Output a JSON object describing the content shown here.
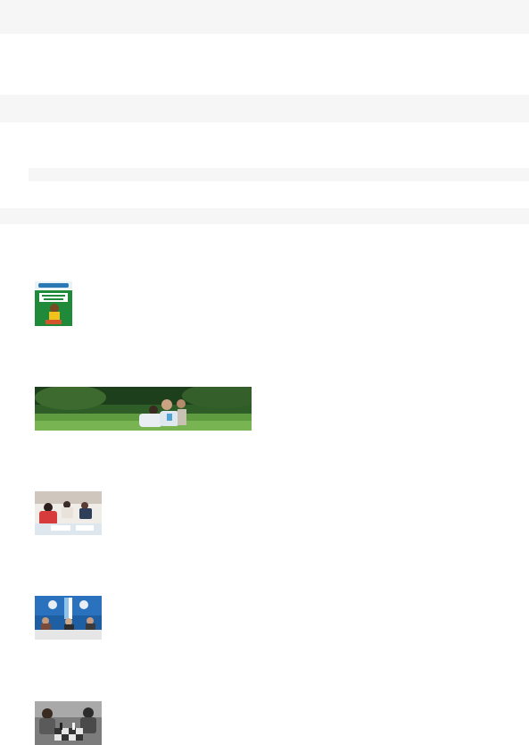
{
  "page": {
    "bands": [
      {
        "id": "top-bar"
      },
      {
        "id": "section-band-1"
      },
      {
        "id": "section-band-2"
      },
      {
        "id": "section-band-3"
      }
    ]
  },
  "thumbnails": [
    {
      "id": "publication-cover",
      "icon": "book-cover-image",
      "colors": [
        "#1f8a3a",
        "#f2c21c",
        "#ffffff"
      ]
    },
    {
      "id": "family-in-park",
      "icon": "park-photo",
      "colors": [
        "#2e5a24",
        "#7fbf5a",
        "#e7e7e7"
      ]
    },
    {
      "id": "classroom-students",
      "icon": "classroom-photo",
      "colors": [
        "#d83b3b",
        "#f4f4f4",
        "#3a2a28"
      ]
    },
    {
      "id": "press-conference",
      "icon": "conference-photo",
      "colors": [
        "#1e73be",
        "#ffffff",
        "#c9c9c9"
      ]
    },
    {
      "id": "chess-children",
      "icon": "chess-photo",
      "colors": [
        "#6a6a6a",
        "#e0e0e0",
        "#2c2c2c"
      ]
    }
  ]
}
